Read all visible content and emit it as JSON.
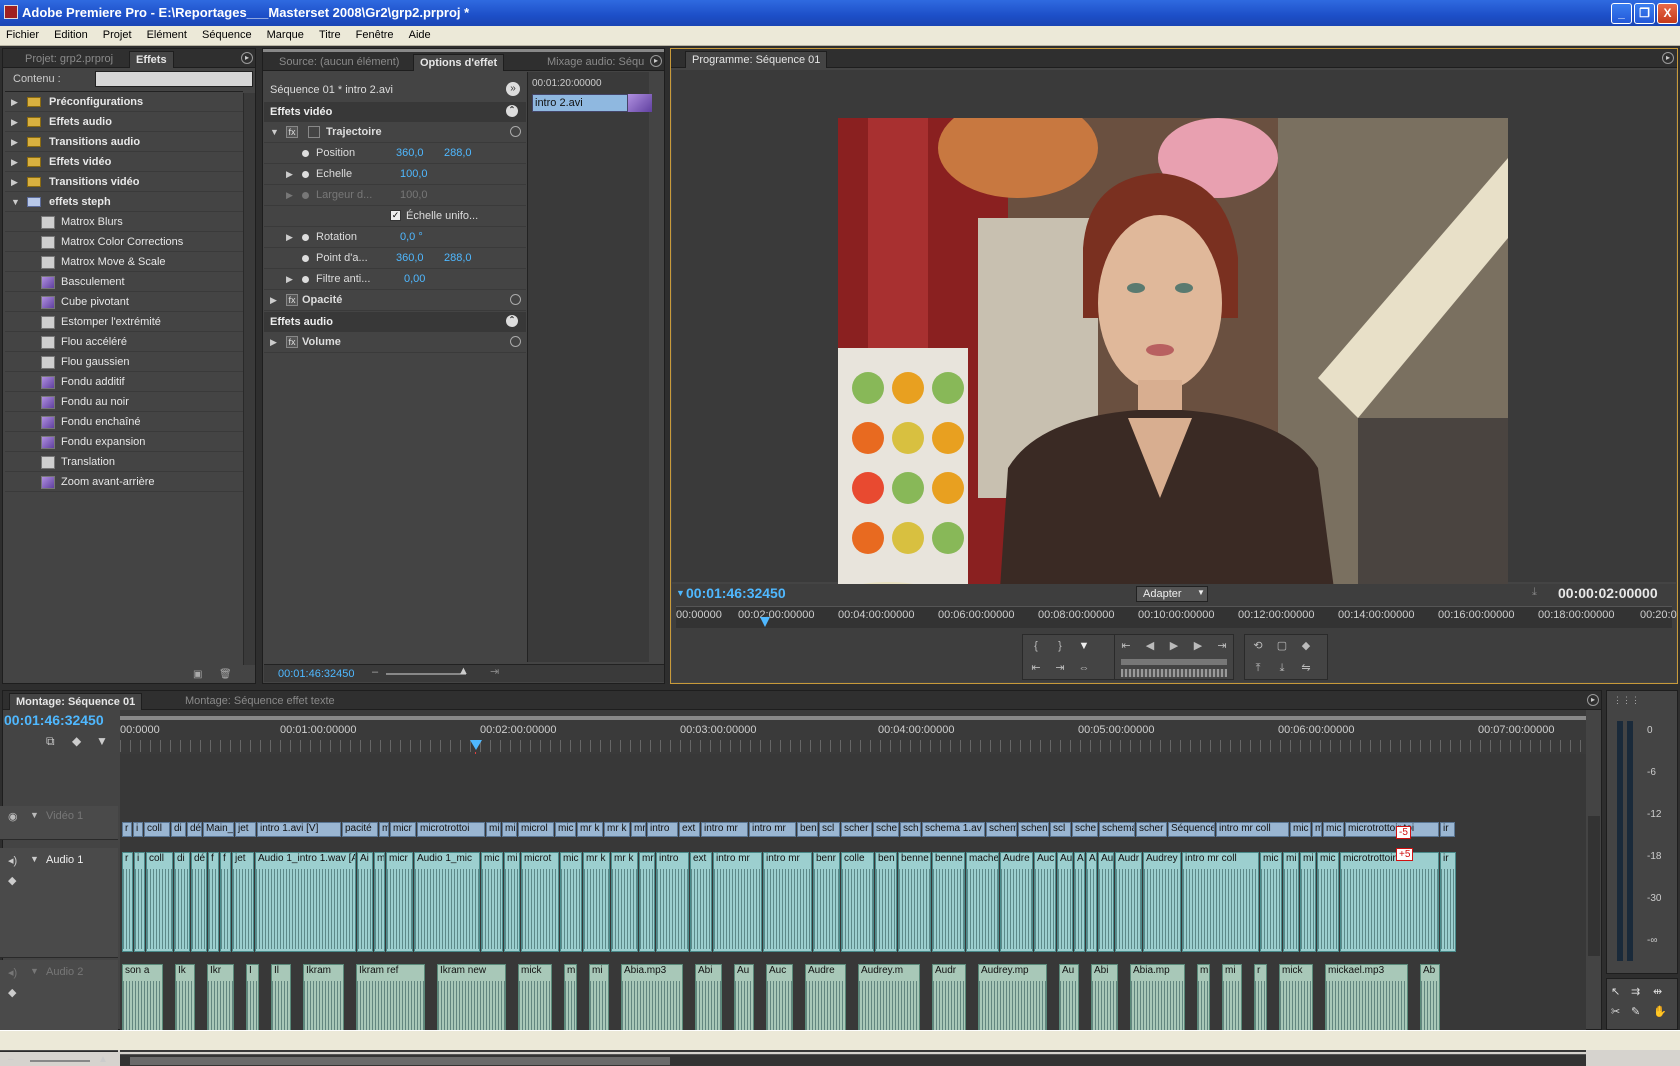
{
  "window": {
    "title": "Adobe Premiere Pro - E:\\Reportages___Masterset 2008\\Gr2\\grp2.prproj *",
    "buttons": [
      "_",
      "❐",
      "X"
    ]
  },
  "menu": [
    "Fichier",
    "Edition",
    "Projet",
    "Elément",
    "Séquence",
    "Marque",
    "Titre",
    "Fenêtre",
    "Aide"
  ],
  "effects_panel": {
    "tabs": [
      "Projet: grp2.prproj",
      "Effets"
    ],
    "search_label": "Contenu :",
    "folders": [
      "Préconfigurations",
      "Effets audio",
      "Transitions audio",
      "Effets vidéo",
      "Transitions vidéo",
      "effets steph"
    ],
    "items": [
      "Matrox Blurs",
      "Matrox Color Corrections",
      "Matrox Move & Scale",
      "Basculement",
      "Cube pivotant",
      "Estomper l'extrémité",
      "Flou accéléré",
      "Flou gaussien",
      "Fondu additif",
      "Fondu au noir",
      "Fondu enchaîné",
      "Fondu expansion",
      "Translation",
      "Zoom avant-arrière"
    ]
  },
  "effect_controls": {
    "tabs": [
      "Source: (aucun élément)",
      "Options d'effet",
      "Mixage audio: Séqu"
    ],
    "clip_label": "Séquence 01 * intro 2.avi",
    "mini_timecode": "00:01:20:00000",
    "mini_clip": "intro 2.avi",
    "video_header": "Effets vidéo",
    "trajectoire": "Trajectoire",
    "position": {
      "label": "Position",
      "x": "360,0",
      "y": "288,0"
    },
    "echelle": {
      "label": "Echelle",
      "value": "100,0"
    },
    "largeur": {
      "label": "Largeur d...",
      "value": "100,0"
    },
    "uniform": "Échelle unifo...",
    "rotation": {
      "label": "Rotation",
      "value": "0,0 °"
    },
    "anchor": {
      "label": "Point d'a...",
      "x": "360,0",
      "y": "288,0"
    },
    "antiflicker": {
      "label": "Filtre anti...",
      "value": "0,00"
    },
    "opacite": "Opacité",
    "audio_header": "Effets audio",
    "volume": "Volume",
    "timecode": "00:01:46:32450"
  },
  "program": {
    "tab": "Programme: Séquence 01",
    "timecode": "00:01:46:32450",
    "duration": "00:00:02:00000",
    "fit": "Adapter",
    "ruler": [
      "00:00000",
      "00:02:00:00000",
      "00:04:00:00000",
      "00:06:00:00000",
      "00:08:00:00000",
      "00:10:00:00000",
      "00:12:00:00000",
      "00:14:00:00000",
      "00:16:00:00000",
      "00:18:00:00000",
      "00:20:0"
    ]
  },
  "timeline": {
    "tabs": [
      "Montage: Séquence 01",
      "Montage: Séquence effet texte"
    ],
    "timecode": "00:01:46:32450",
    "ruler": [
      "00:0000",
      "00:01:00:00000",
      "00:02:00:00000",
      "00:03:00:00000",
      "00:04:00:00000",
      "00:05:00:00000",
      "00:06:00:00000",
      "00:07:00:00000"
    ],
    "tracks": {
      "video": "Vidéo 1",
      "audio1": "Audio 1",
      "audio2": "Audio 2"
    },
    "video_clips": [
      "r",
      "i",
      "coll",
      "di",
      "dé",
      "Main_",
      "jet",
      "intro 1.avi [V]",
      "pacité",
      "m",
      "micr",
      "microtrottoi",
      "mi",
      "mi",
      "microl",
      "mic",
      "mr k",
      "mr k",
      "mr",
      "intro",
      "ext",
      "intro mr",
      "intro mr",
      "ben",
      "scl",
      "scher",
      "sche",
      "sch",
      "schema 1.av",
      "schem",
      "schen",
      "scl",
      "sche",
      "schema",
      "scher",
      "Séquence",
      "intro mr coll",
      "mic",
      "m",
      "mic",
      "microtrottoir toi",
      "ir"
    ],
    "audio1_clips": [
      "r",
      "i",
      "coll",
      "di",
      "dé",
      "f",
      "f",
      "jet",
      "Audio 1_intro 1.wav [A]",
      "Ai",
      "m",
      "micr",
      "Audio 1_mic",
      "mic",
      "mi",
      "microt",
      "mic",
      "mr k",
      "mr k",
      "mr",
      "intro",
      "ext",
      "intro mr",
      "intro mr",
      "benr",
      "colle",
      "ben",
      "benne",
      "benne",
      "mache",
      "Audre",
      "Auc",
      "Au",
      "A",
      "A",
      "Au",
      "Audr",
      "Audrey",
      "intro mr coll",
      "mic",
      "mi",
      "mi",
      "mic",
      "microtrottoir toi",
      "ir"
    ],
    "audio2_clips": [
      "son a",
      "Ik",
      "Ikr",
      "I",
      "Il",
      "Ikram",
      "Ikram ref",
      "Ikram new",
      "mick",
      "m",
      "mi",
      "Abia.mp3",
      "Abi",
      "Au",
      "Auc",
      "Audre",
      "Audrey.m",
      "Audr",
      "Audrey.mp",
      "Au",
      "Abi",
      "Abia.mp",
      "m",
      "mi",
      "r",
      "mick",
      "mickael.mp3",
      "Ab"
    ],
    "vu_ticks": [
      "0",
      "-6",
      "-12",
      "-18",
      "-30",
      "-∞"
    ],
    "badges": [
      "-5",
      "+5"
    ]
  }
}
